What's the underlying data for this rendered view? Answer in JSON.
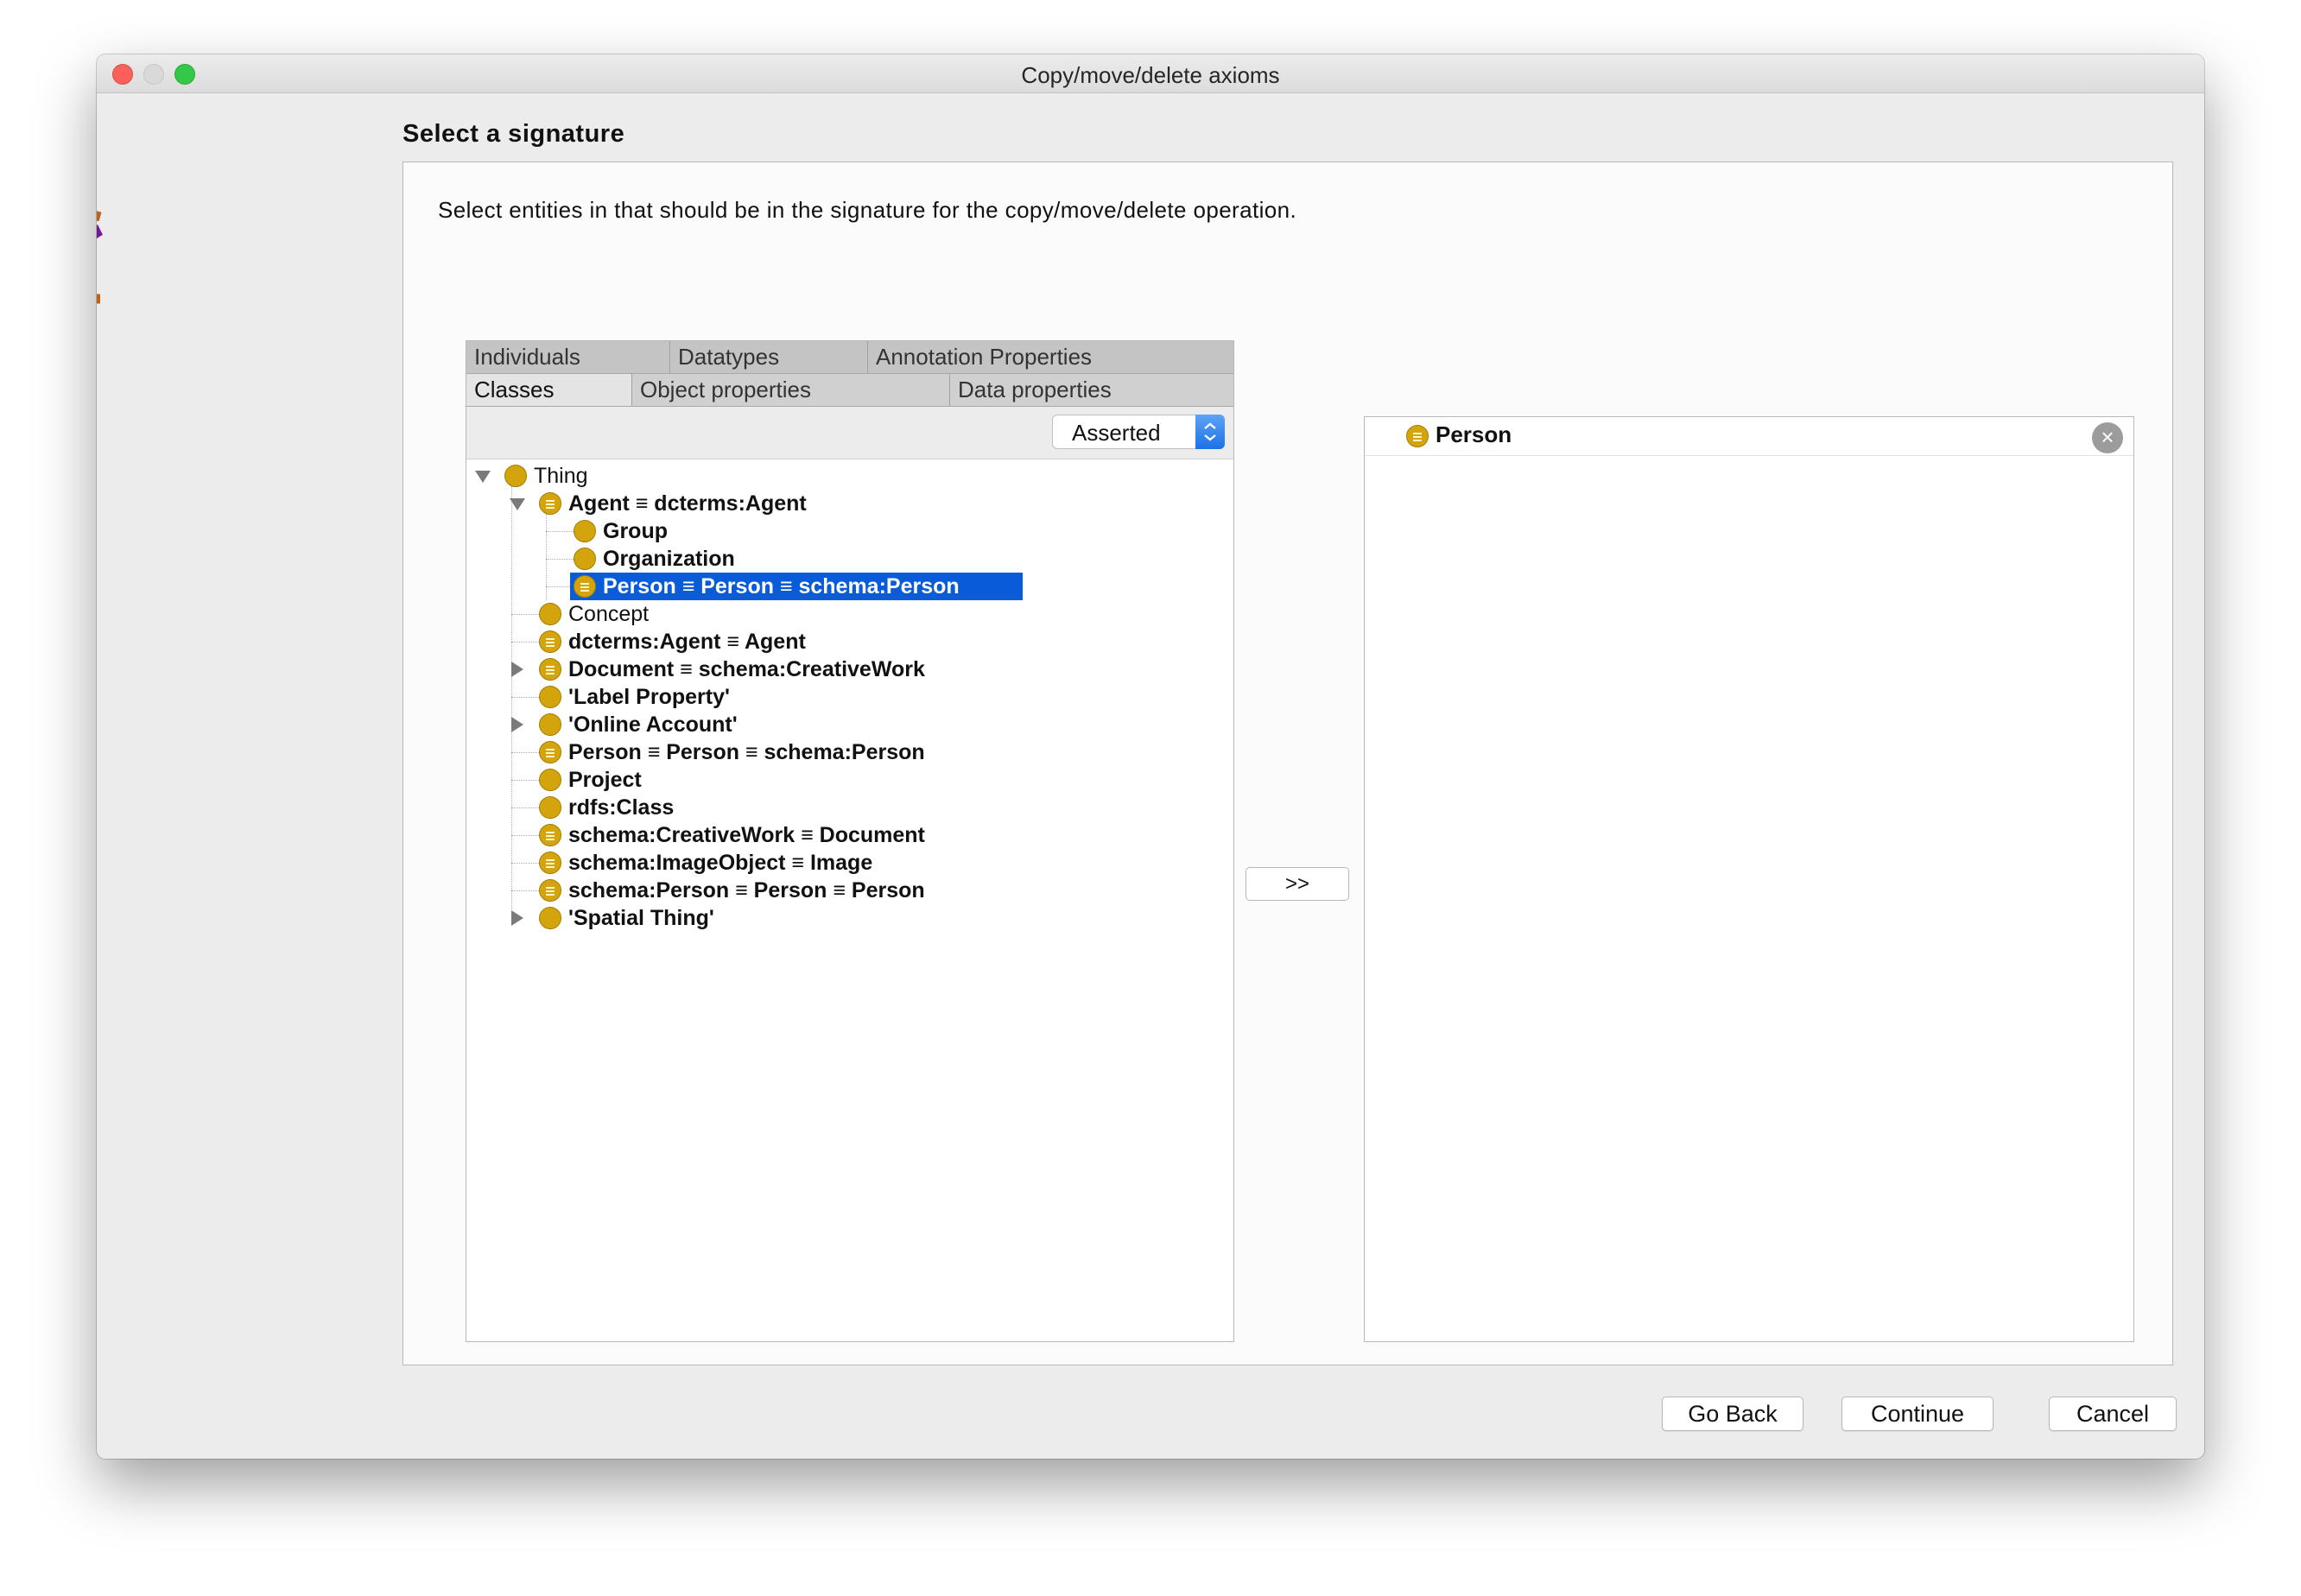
{
  "window": {
    "title": "Copy/move/delete axioms"
  },
  "page": {
    "heading": "Select a signature",
    "instructions": "Select entities in that should be in the signature for the copy/move/delete operation."
  },
  "tabs": {
    "row1": [
      "Individuals",
      "Datatypes",
      "Annotation Properties"
    ],
    "row2": [
      "Classes",
      "Object properties",
      "Data properties"
    ],
    "selected": "Classes"
  },
  "hierarchy_select": {
    "value": "Asserted"
  },
  "tree": {
    "root": "Thing",
    "nodes": [
      {
        "label": "Agent ≡ dcterms:Agent"
      },
      {
        "label": "Group"
      },
      {
        "label": "Organization"
      },
      {
        "label": "Person ≡ Person ≡ schema:Person",
        "selected": true
      },
      {
        "label": "Concept"
      },
      {
        "label": "dcterms:Agent ≡ Agent"
      },
      {
        "label": "Document ≡ schema:CreativeWork"
      },
      {
        "label": "'Label Property'"
      },
      {
        "label": "'Online Account'"
      },
      {
        "label": "Person ≡ Person ≡ schema:Person"
      },
      {
        "label": "Project"
      },
      {
        "label": "rdfs:Class"
      },
      {
        "label": "schema:CreativeWork ≡ Document"
      },
      {
        "label": "schema:ImageObject ≡ Image"
      },
      {
        "label": "schema:Person ≡ Person ≡ Person"
      },
      {
        "label": "'Spatial Thing'"
      }
    ]
  },
  "transfer_button": {
    "label": ">>"
  },
  "signature": {
    "items": [
      "Person"
    ]
  },
  "footer": {
    "go_back": "Go Back",
    "continue": "Continue",
    "cancel": "Cancel"
  },
  "colors": {
    "class_icon": "#d3a40c",
    "selection": "#0a5bd8",
    "select_arrow": "#1c72e5"
  },
  "icons": {
    "class": "class-icon",
    "equivalent_class": "equivalent-class-icon",
    "remove": "close-icon"
  }
}
